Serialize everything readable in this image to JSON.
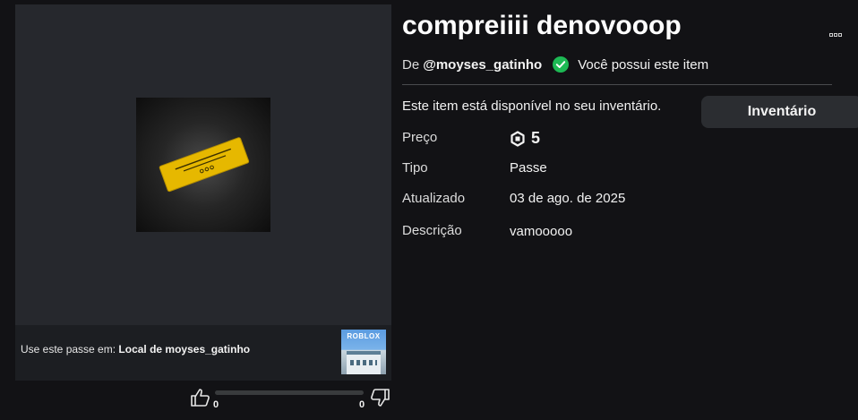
{
  "item": {
    "title": "compreiiii denovooop",
    "creator_prefix": "De",
    "creator_name": "@moyses_gatinho",
    "owned_text": "Você possui este item",
    "availability_text": "Este item está disponível no seu inventário.",
    "inventory_button": "Inventário"
  },
  "details": {
    "price_label": "Preço",
    "price_value": "5",
    "type_label": "Tipo",
    "type_value": "Passe",
    "updated_label": "Atualizado",
    "updated_value": "03 de ago. de 2025",
    "description_label": "Descrição",
    "description_value": "vamooooo"
  },
  "usage": {
    "prefix": "Use este passe em:",
    "place_name": "Local de moyses_gatinho",
    "place_logo_text": "ROBLOX"
  },
  "votes": {
    "up": "0",
    "down": "0"
  },
  "icons": {
    "owned": "check-circle-icon",
    "currency": "robux-icon",
    "upvote": "thumbs-up-icon",
    "downvote": "thumbs-down-icon",
    "more": "more-options-icon"
  },
  "colors": {
    "background": "#121215",
    "owned_check": "#1db954",
    "ticket": "#e6b800"
  }
}
